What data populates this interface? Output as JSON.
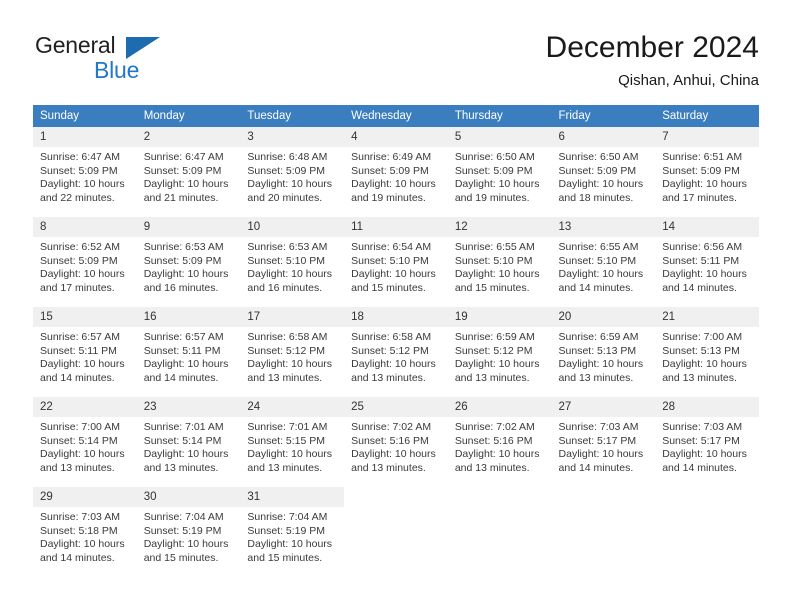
{
  "logo": {
    "word1": "General",
    "word2": "Blue",
    "triangle_color": "#1e6cb0",
    "word2_color": "#2277c8"
  },
  "header": {
    "title": "December 2024",
    "subtitle": "Qishan, Anhui, China",
    "header_bg": "#3b7ebf",
    "daynum_bg": "#f0f0f0"
  },
  "weekday_headers": [
    "Sunday",
    "Monday",
    "Tuesday",
    "Wednesday",
    "Thursday",
    "Friday",
    "Saturday"
  ],
  "weeks": [
    [
      {
        "day": "1",
        "sunrise": "Sunrise: 6:47 AM",
        "sunset": "Sunset: 5:09 PM",
        "daylight1": "Daylight: 10 hours",
        "daylight2": "and 22 minutes."
      },
      {
        "day": "2",
        "sunrise": "Sunrise: 6:47 AM",
        "sunset": "Sunset: 5:09 PM",
        "daylight1": "Daylight: 10 hours",
        "daylight2": "and 21 minutes."
      },
      {
        "day": "3",
        "sunrise": "Sunrise: 6:48 AM",
        "sunset": "Sunset: 5:09 PM",
        "daylight1": "Daylight: 10 hours",
        "daylight2": "and 20 minutes."
      },
      {
        "day": "4",
        "sunrise": "Sunrise: 6:49 AM",
        "sunset": "Sunset: 5:09 PM",
        "daylight1": "Daylight: 10 hours",
        "daylight2": "and 19 minutes."
      },
      {
        "day": "5",
        "sunrise": "Sunrise: 6:50 AM",
        "sunset": "Sunset: 5:09 PM",
        "daylight1": "Daylight: 10 hours",
        "daylight2": "and 19 minutes."
      },
      {
        "day": "6",
        "sunrise": "Sunrise: 6:50 AM",
        "sunset": "Sunset: 5:09 PM",
        "daylight1": "Daylight: 10 hours",
        "daylight2": "and 18 minutes."
      },
      {
        "day": "7",
        "sunrise": "Sunrise: 6:51 AM",
        "sunset": "Sunset: 5:09 PM",
        "daylight1": "Daylight: 10 hours",
        "daylight2": "and 17 minutes."
      }
    ],
    [
      {
        "day": "8",
        "sunrise": "Sunrise: 6:52 AM",
        "sunset": "Sunset: 5:09 PM",
        "daylight1": "Daylight: 10 hours",
        "daylight2": "and 17 minutes."
      },
      {
        "day": "9",
        "sunrise": "Sunrise: 6:53 AM",
        "sunset": "Sunset: 5:09 PM",
        "daylight1": "Daylight: 10 hours",
        "daylight2": "and 16 minutes."
      },
      {
        "day": "10",
        "sunrise": "Sunrise: 6:53 AM",
        "sunset": "Sunset: 5:10 PM",
        "daylight1": "Daylight: 10 hours",
        "daylight2": "and 16 minutes."
      },
      {
        "day": "11",
        "sunrise": "Sunrise: 6:54 AM",
        "sunset": "Sunset: 5:10 PM",
        "daylight1": "Daylight: 10 hours",
        "daylight2": "and 15 minutes."
      },
      {
        "day": "12",
        "sunrise": "Sunrise: 6:55 AM",
        "sunset": "Sunset: 5:10 PM",
        "daylight1": "Daylight: 10 hours",
        "daylight2": "and 15 minutes."
      },
      {
        "day": "13",
        "sunrise": "Sunrise: 6:55 AM",
        "sunset": "Sunset: 5:10 PM",
        "daylight1": "Daylight: 10 hours",
        "daylight2": "and 14 minutes."
      },
      {
        "day": "14",
        "sunrise": "Sunrise: 6:56 AM",
        "sunset": "Sunset: 5:11 PM",
        "daylight1": "Daylight: 10 hours",
        "daylight2": "and 14 minutes."
      }
    ],
    [
      {
        "day": "15",
        "sunrise": "Sunrise: 6:57 AM",
        "sunset": "Sunset: 5:11 PM",
        "daylight1": "Daylight: 10 hours",
        "daylight2": "and 14 minutes."
      },
      {
        "day": "16",
        "sunrise": "Sunrise: 6:57 AM",
        "sunset": "Sunset: 5:11 PM",
        "daylight1": "Daylight: 10 hours",
        "daylight2": "and 14 minutes."
      },
      {
        "day": "17",
        "sunrise": "Sunrise: 6:58 AM",
        "sunset": "Sunset: 5:12 PM",
        "daylight1": "Daylight: 10 hours",
        "daylight2": "and 13 minutes."
      },
      {
        "day": "18",
        "sunrise": "Sunrise: 6:58 AM",
        "sunset": "Sunset: 5:12 PM",
        "daylight1": "Daylight: 10 hours",
        "daylight2": "and 13 minutes."
      },
      {
        "day": "19",
        "sunrise": "Sunrise: 6:59 AM",
        "sunset": "Sunset: 5:12 PM",
        "daylight1": "Daylight: 10 hours",
        "daylight2": "and 13 minutes."
      },
      {
        "day": "20",
        "sunrise": "Sunrise: 6:59 AM",
        "sunset": "Sunset: 5:13 PM",
        "daylight1": "Daylight: 10 hours",
        "daylight2": "and 13 minutes."
      },
      {
        "day": "21",
        "sunrise": "Sunrise: 7:00 AM",
        "sunset": "Sunset: 5:13 PM",
        "daylight1": "Daylight: 10 hours",
        "daylight2": "and 13 minutes."
      }
    ],
    [
      {
        "day": "22",
        "sunrise": "Sunrise: 7:00 AM",
        "sunset": "Sunset: 5:14 PM",
        "daylight1": "Daylight: 10 hours",
        "daylight2": "and 13 minutes."
      },
      {
        "day": "23",
        "sunrise": "Sunrise: 7:01 AM",
        "sunset": "Sunset: 5:14 PM",
        "daylight1": "Daylight: 10 hours",
        "daylight2": "and 13 minutes."
      },
      {
        "day": "24",
        "sunrise": "Sunrise: 7:01 AM",
        "sunset": "Sunset: 5:15 PM",
        "daylight1": "Daylight: 10 hours",
        "daylight2": "and 13 minutes."
      },
      {
        "day": "25",
        "sunrise": "Sunrise: 7:02 AM",
        "sunset": "Sunset: 5:16 PM",
        "daylight1": "Daylight: 10 hours",
        "daylight2": "and 13 minutes."
      },
      {
        "day": "26",
        "sunrise": "Sunrise: 7:02 AM",
        "sunset": "Sunset: 5:16 PM",
        "daylight1": "Daylight: 10 hours",
        "daylight2": "and 13 minutes."
      },
      {
        "day": "27",
        "sunrise": "Sunrise: 7:03 AM",
        "sunset": "Sunset: 5:17 PM",
        "daylight1": "Daylight: 10 hours",
        "daylight2": "and 14 minutes."
      },
      {
        "day": "28",
        "sunrise": "Sunrise: 7:03 AM",
        "sunset": "Sunset: 5:17 PM",
        "daylight1": "Daylight: 10 hours",
        "daylight2": "and 14 minutes."
      }
    ],
    [
      {
        "day": "29",
        "sunrise": "Sunrise: 7:03 AM",
        "sunset": "Sunset: 5:18 PM",
        "daylight1": "Daylight: 10 hours",
        "daylight2": "and 14 minutes."
      },
      {
        "day": "30",
        "sunrise": "Sunrise: 7:04 AM",
        "sunset": "Sunset: 5:19 PM",
        "daylight1": "Daylight: 10 hours",
        "daylight2": "and 15 minutes."
      },
      {
        "day": "31",
        "sunrise": "Sunrise: 7:04 AM",
        "sunset": "Sunset: 5:19 PM",
        "daylight1": "Daylight: 10 hours",
        "daylight2": "and 15 minutes."
      },
      {
        "day": "",
        "sunrise": "",
        "sunset": "",
        "daylight1": "",
        "daylight2": ""
      },
      {
        "day": "",
        "sunrise": "",
        "sunset": "",
        "daylight1": "",
        "daylight2": ""
      },
      {
        "day": "",
        "sunrise": "",
        "sunset": "",
        "daylight1": "",
        "daylight2": ""
      },
      {
        "day": "",
        "sunrise": "",
        "sunset": "",
        "daylight1": "",
        "daylight2": ""
      }
    ]
  ]
}
